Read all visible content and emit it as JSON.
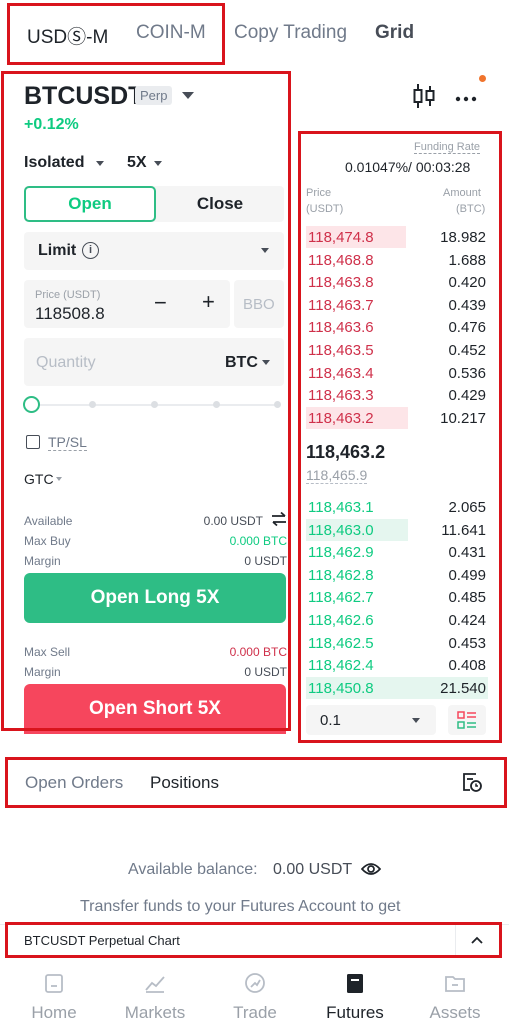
{
  "top_tabs": [
    {
      "label": "USDⓈ-M",
      "active": true
    },
    {
      "label": "COIN-M",
      "active": false
    },
    {
      "label": "Copy Trading",
      "active": false
    },
    {
      "label": "Grid",
      "active": false
    }
  ],
  "symbol": {
    "name": "BTCUSDT",
    "badge": "Perp",
    "change": "+0.12%"
  },
  "funding": {
    "label": "Funding Rate",
    "value": "0.01047%/ 00:03:28"
  },
  "order_form": {
    "margin_mode": "Isolated",
    "leverage": "5X",
    "open_label": "Open",
    "close_label": "Close",
    "order_type": "Limit",
    "price_label": "Price (USDT)",
    "price_value": "118508.8",
    "minus": "−",
    "plus": "+",
    "bbo": "BBO",
    "quantity_placeholder": "Quantity",
    "quantity_unit": "BTC",
    "slider_percent": 0,
    "tpsl_label": "TP/SL",
    "tif": "GTC",
    "available_label": "Available",
    "available_value": "0.00 USDT",
    "max_buy_label": "Max Buy",
    "max_buy_value": "0.000 BTC",
    "margin_label": "Margin",
    "margin_buy_value": "0 USDT",
    "open_long_label": "Open Long 5X",
    "max_sell_label": "Max Sell",
    "max_sell_value": "0.000 BTC",
    "margin_sell_value": "0 USDT",
    "open_short_label": "Open Short 5X"
  },
  "order_book": {
    "price_header": "Price",
    "price_unit": "(USDT)",
    "amount_header": "Amount",
    "amount_unit": "(BTC)",
    "asks": [
      {
        "price": "118,474.8",
        "amount": "18.982",
        "depth": 0.55
      },
      {
        "price": "118,468.8",
        "amount": "1.688",
        "depth": 0
      },
      {
        "price": "118,463.8",
        "amount": "0.420",
        "depth": 0
      },
      {
        "price": "118,463.7",
        "amount": "0.439",
        "depth": 0
      },
      {
        "price": "118,463.6",
        "amount": "0.476",
        "depth": 0
      },
      {
        "price": "118,463.5",
        "amount": "0.452",
        "depth": 0
      },
      {
        "price": "118,463.4",
        "amount": "0.536",
        "depth": 0
      },
      {
        "price": "118,463.3",
        "amount": "0.429",
        "depth": 0
      },
      {
        "price": "118,463.2",
        "amount": "10.217",
        "depth": 0.56
      }
    ],
    "last_price": "118,463.2",
    "mark_price": "118,465.9",
    "bids": [
      {
        "price": "118,463.1",
        "amount": "2.065",
        "depth": 0
      },
      {
        "price": "118,463.0",
        "amount": "11.641",
        "depth": 0.56
      },
      {
        "price": "118,462.9",
        "amount": "0.431",
        "depth": 0
      },
      {
        "price": "118,462.8",
        "amount": "0.499",
        "depth": 0
      },
      {
        "price": "118,462.7",
        "amount": "0.485",
        "depth": 0
      },
      {
        "price": "118,462.6",
        "amount": "0.424",
        "depth": 0
      },
      {
        "price": "118,462.5",
        "amount": "0.453",
        "depth": 0
      },
      {
        "price": "118,462.4",
        "amount": "0.408",
        "depth": 0
      },
      {
        "price": "118,450.8",
        "amount": "21.540",
        "depth": 1.0
      }
    ],
    "precision": "0.1"
  },
  "positions": {
    "tab_open_orders": "Open Orders",
    "tab_positions": "Positions",
    "available_balance": "Available balance:",
    "available_balance_value": "0.00 USDT",
    "transfer_text": "Transfer funds to your Futures Account to get"
  },
  "chart_bar": {
    "label": "BTCUSDT Perpetual Chart"
  },
  "bottom_nav": [
    {
      "label": "Home",
      "icon": "home-icon",
      "active": false
    },
    {
      "label": "Markets",
      "icon": "markets-icon",
      "active": false
    },
    {
      "label": "Trade",
      "icon": "trade-icon",
      "active": false
    },
    {
      "label": "Futures",
      "icon": "futures-icon",
      "active": true
    },
    {
      "label": "Assets",
      "icon": "assets-icon",
      "active": false
    }
  ],
  "colors": {
    "buy": "#2ebd85",
    "sell": "#f6465d",
    "highlight": "#d9141c"
  }
}
